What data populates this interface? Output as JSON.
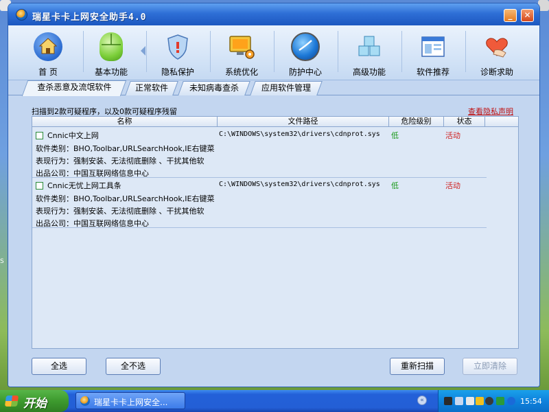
{
  "window": {
    "title": "瑞星卡卡上网安全助手4.0",
    "min_label": "_",
    "close_label": "✕"
  },
  "toolbar": {
    "items": [
      {
        "label": "首 页",
        "icon": "home-icon"
      },
      {
        "label": "基本功能",
        "icon": "mouse-icon"
      },
      {
        "label": "隐私保护",
        "icon": "shield-icon"
      },
      {
        "label": "系统优化",
        "icon": "monitor-gear-icon"
      },
      {
        "label": "防护中心",
        "icon": "globe-icon"
      },
      {
        "label": "高级功能",
        "icon": "cubes-icon"
      },
      {
        "label": "软件推荐",
        "icon": "window-icon"
      },
      {
        "label": "诊断求助",
        "icon": "heart-hand-icon"
      }
    ]
  },
  "subtabs": [
    {
      "label": "查杀恶意及流氓软件",
      "active": true
    },
    {
      "label": "正常软件",
      "active": false
    },
    {
      "label": "未知病毒查杀",
      "active": false
    },
    {
      "label": "应用软件管理",
      "active": false
    }
  ],
  "content": {
    "scan_summary": "扫描到2款可疑程序，以及0款可疑程序残留",
    "privacy_link": "查看隐私声明",
    "columns": [
      "名称",
      "文件路径",
      "危险级别",
      "状态"
    ],
    "rows": [
      {
        "name": "Cnnic中文上网",
        "path": "C:\\WINDOWS\\system32\\drivers\\cdnprot.sys",
        "risk": "低",
        "status": "活动",
        "category": "软件类别：BHO,Toolbar,URLSearchHook,IE右键菜",
        "behavior": "表现行为：强制安装、无法彻底删除 、干扰其他软",
        "company": "出品公司：中国互联网络信息中心"
      },
      {
        "name": "Cnnic无忧上网工具条",
        "path": "C:\\WINDOWS\\system32\\drivers\\cdnprot.sys",
        "risk": "低",
        "status": "活动",
        "category": "软件类别：BHO,Toolbar,URLSearchHook,IE右键菜",
        "behavior": "表现行为：强制安装、无法彻底删除 、干扰其他软",
        "company": "出品公司：中国互联网络信息中心"
      }
    ]
  },
  "buttons": {
    "select_all": "全选",
    "select_none": "全不选",
    "rescan": "重新扫描",
    "clean_now": "立即清除"
  },
  "taskbar": {
    "start": "开始",
    "task": "瑞星卡卡上网安全...",
    "clock": "15:54",
    "tray_chevron": "«"
  },
  "desktop": {
    "left_label": "S"
  },
  "colors": {
    "risk_low": "#1a9a1a",
    "status_active": "#d02020",
    "privacy_link": "#c01010"
  }
}
